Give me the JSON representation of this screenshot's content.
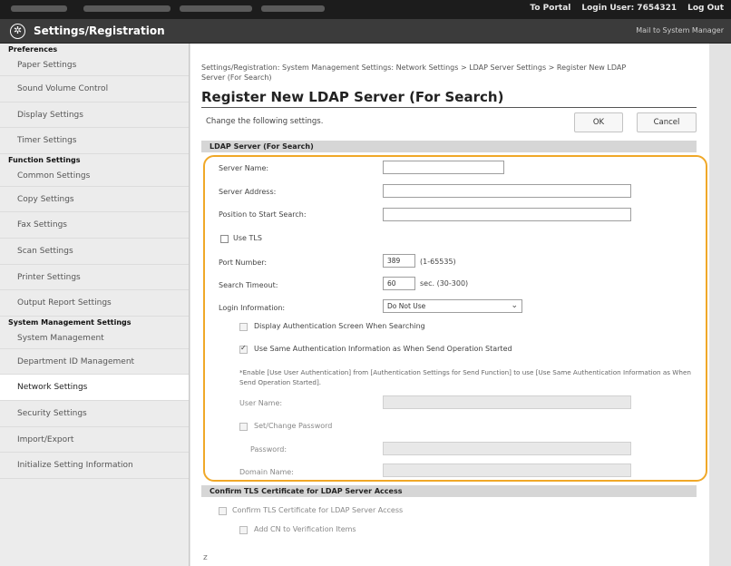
{
  "topbar": {
    "to_portal": "To Portal",
    "login_user": "Login User: 7654321",
    "logout": "Log Out"
  },
  "header": {
    "title": "Settings/Registration",
    "mail": "Mail to System Manager"
  },
  "sidebar": {
    "preferences_head": "Preferences",
    "preferences": [
      "Paper Settings",
      "Sound Volume Control",
      "Display Settings",
      "Timer Settings"
    ],
    "function_head": "Function Settings",
    "functions": [
      "Common Settings",
      "Copy Settings",
      "Fax Settings",
      "Scan Settings",
      "Printer Settings",
      "Output Report Settings"
    ],
    "system_head": "System Management Settings",
    "system": [
      "System Management",
      "Department ID Management",
      "Network Settings",
      "Security Settings",
      "Import/Export",
      "Initialize Setting Information"
    ]
  },
  "main": {
    "breadcrumb_line1": "Settings/Registration: System Management Settings: Network Settings > LDAP Server Settings > Register New LDAP",
    "breadcrumb_line2": "Server (For Search)",
    "title": "Register New LDAP Server (For Search)",
    "instruction": "Change the following settings.",
    "ok_label": "OK",
    "cancel_label": "Cancel",
    "section_ldap": "LDAP Server (For Search)",
    "fields": {
      "server_name_label": "Server Name:",
      "server_name_value": "",
      "server_address_label": "Server Address:",
      "server_address_value": "",
      "position_label": "Position to Start Search:",
      "position_value": "",
      "use_tls_label": "Use TLS",
      "port_label": "Port Number:",
      "port_value": "389",
      "port_range": "(1-65535)",
      "timeout_label": "Search Timeout:",
      "timeout_value": "60",
      "timeout_range": "sec. (30-300)",
      "login_info_label": "Login Information:",
      "login_info_value": "Do Not Use",
      "display_auth_label": "Display Authentication Screen When Searching",
      "use_same_auth_label": "Use Same Authentication Information as When Send Operation Started",
      "note_text": "*Enable [Use User Authentication] from [Authentication Settings for Send Function] to use [Use Same Authentication Information as When Send Operation Started].",
      "user_name_label": "User Name:",
      "set_password_label": "Set/Change Password",
      "password_label": "Password:",
      "domain_label": "Domain Name:"
    },
    "section_tls": "Confirm TLS Certificate for LDAP Server Access",
    "confirm_tls_label": "Confirm TLS Certificate for LDAP Server Access",
    "add_cn_label": "Add CN to Verification Items",
    "bottom_mark": "z"
  }
}
